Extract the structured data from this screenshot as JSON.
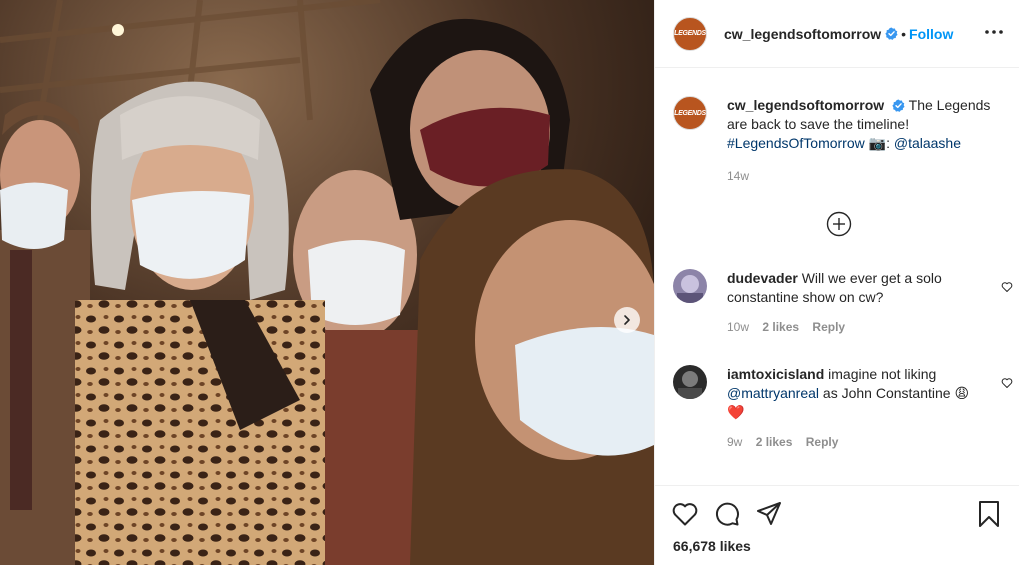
{
  "post": {
    "account": {
      "username": "cw_legendsoftomorrow",
      "avatar_text": "LEGENDS",
      "verified": true,
      "follow_label": "Follow",
      "separator": "•"
    },
    "caption": {
      "username": "cw_legendsoftomorrow",
      "text": "The Legends are back to save the timeline!",
      "hashtag": "#LegendsOfTomorrow",
      "camera_emoji": "📷",
      "colon": ":",
      "mention": "@talaashe",
      "time": "14w"
    },
    "comments": [
      {
        "username": "dudevader",
        "text": "Will we ever get a solo constantine show on cw?",
        "time": "10w",
        "likes": "2 likes",
        "reply_label": "Reply"
      },
      {
        "username": "iamtoxicisland",
        "text": "imagine not liking",
        "mention": "@mattryanreal",
        "text_after": "as John Constantine",
        "emojis": "😩❤️",
        "time": "9w",
        "likes": "2 likes",
        "reply_label": "Reply"
      }
    ],
    "likes_count": "66,678 likes"
  },
  "icons": {
    "like": "heart-icon",
    "comment": "comment-icon",
    "share": "paper-plane-icon",
    "save": "bookmark-icon",
    "more": "more-options-icon",
    "next": "chevron-right-icon",
    "load_more": "plus-circle-icon"
  },
  "colors": {
    "follow": "#0095f6",
    "text": "#262626",
    "secondary": "#8e8e8e",
    "link": "#00376b",
    "verified": "#3897f0"
  }
}
